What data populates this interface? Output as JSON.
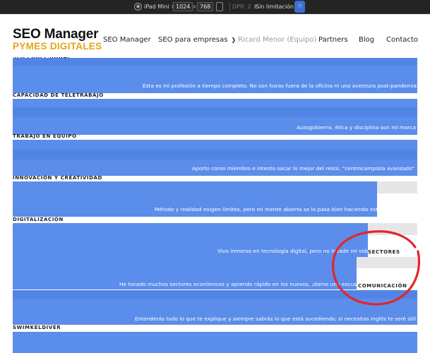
{
  "devtools": {
    "device_label": "iPad Mini",
    "width_value": "1024",
    "times": "×",
    "height_value": "768",
    "dpr_label": "DPR: 2",
    "throttle_label": "Sin limitación"
  },
  "header": {
    "logo_title": "SEO Manager",
    "logo_subtitle": "PYMES DIGITALES",
    "nav": [
      "SEO Manager",
      "SEO para empresas",
      "Ricard Menor (Equipo)",
      "Partners",
      "Blog",
      "Contacto"
    ]
  },
  "skills": {
    "partial_label": "SEO PROFESIONAL",
    "rows": [
      {
        "text": "Esta es mi profesión a tiempo completo. No son horas fuera de la oficina ni una aventura post-pandemia"
      },
      {
        "label": "CAPACIDAD DE TELETRABAJO",
        "text": "Autogobierno, ética y disciplina son mi marca"
      },
      {
        "label": "TRABAJO EN EQUIPO",
        "text": "Aporto como miembro e intento sacar lo mejor del resto, \"centrocampista avanzado\""
      },
      {
        "label": "INNOVACIÓN Y CREATIVIDAD",
        "text": "Método y realidad exigen límites, pero mi mente abierta se lo pasa bien haciendo esto."
      },
      {
        "label": "DIGITALIZACIÓN",
        "text": "Vivo inmerso en tecnología digital, pero no invade mi vida"
      },
      {
        "text": "He tocado muchos sectores económicos y aprendo rápido en los nuevos, ¡dame una excusa!"
      },
      {
        "text": "Entenderás todo lo que te explique y siempre sabrás lo que está sucediendo; si necesitas Inglés te seré útil"
      }
    ],
    "last_label": "SWIMKELDIVER",
    "side_labels": [
      "SECTORES",
      "COMUNICACIÓN"
    ]
  }
}
